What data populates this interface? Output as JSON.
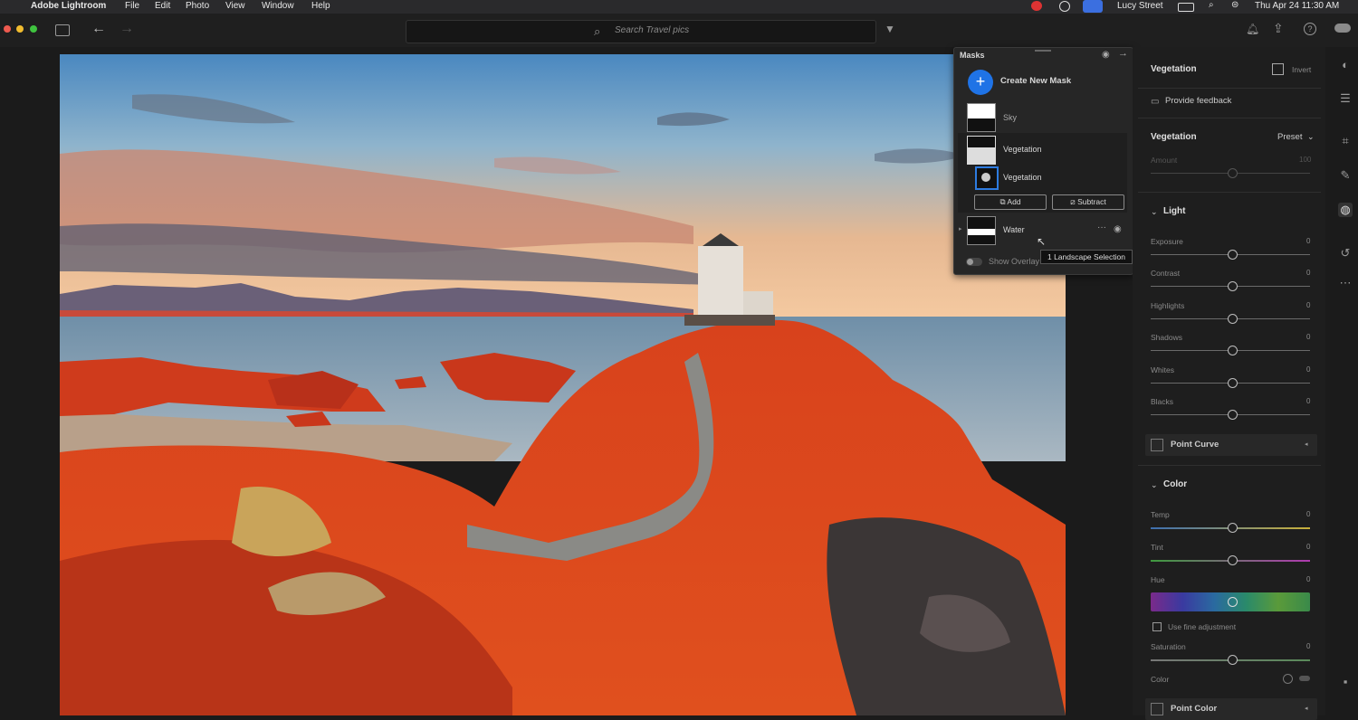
{
  "menubar": {
    "app": "Adobe Lightroom",
    "items": [
      "File",
      "Edit",
      "Photo",
      "View",
      "Window",
      "Help"
    ],
    "user": "Lucy Street",
    "datetime": "Thu Apr 24  11:30 AM"
  },
  "search": {
    "placeholder": "Search Travel pics"
  },
  "masks": {
    "title": "Masks",
    "create_label": "Create New Mask",
    "sky_label": "Sky",
    "vegetation_label": "Vegetation",
    "vegetation_sub_label": "Vegetation",
    "add_label": "Add",
    "subtract_label": "Subtract",
    "water_label": "Water",
    "show_overlay_label": "Show Overlay",
    "tooltip": "1 Landscape Selection"
  },
  "panel": {
    "mask_name": "Vegetation",
    "invert_label": "Invert",
    "feedback_label": "Provide feedback",
    "section_title": "Vegetation",
    "preset_label": "Preset",
    "amount_label": "Amount",
    "amount_value": "100",
    "light_title": "Light",
    "light_sliders": [
      {
        "label": "Exposure",
        "value": "0"
      },
      {
        "label": "Contrast",
        "value": "0"
      },
      {
        "label": "Highlights",
        "value": "0"
      },
      {
        "label": "Shadows",
        "value": "0"
      },
      {
        "label": "Whites",
        "value": "0"
      },
      {
        "label": "Blacks",
        "value": "0"
      }
    ],
    "point_curve_label": "Point Curve",
    "color_title": "Color",
    "temp_label": "Temp",
    "temp_value": "0",
    "tint_label": "Tint",
    "tint_value": "0",
    "hue_label": "Hue",
    "hue_value": "0",
    "fine_adjust_label": "Use fine adjustment",
    "saturation_label": "Saturation",
    "saturation_value": "0",
    "color_label": "Color",
    "point_color_label": "Point Color"
  }
}
